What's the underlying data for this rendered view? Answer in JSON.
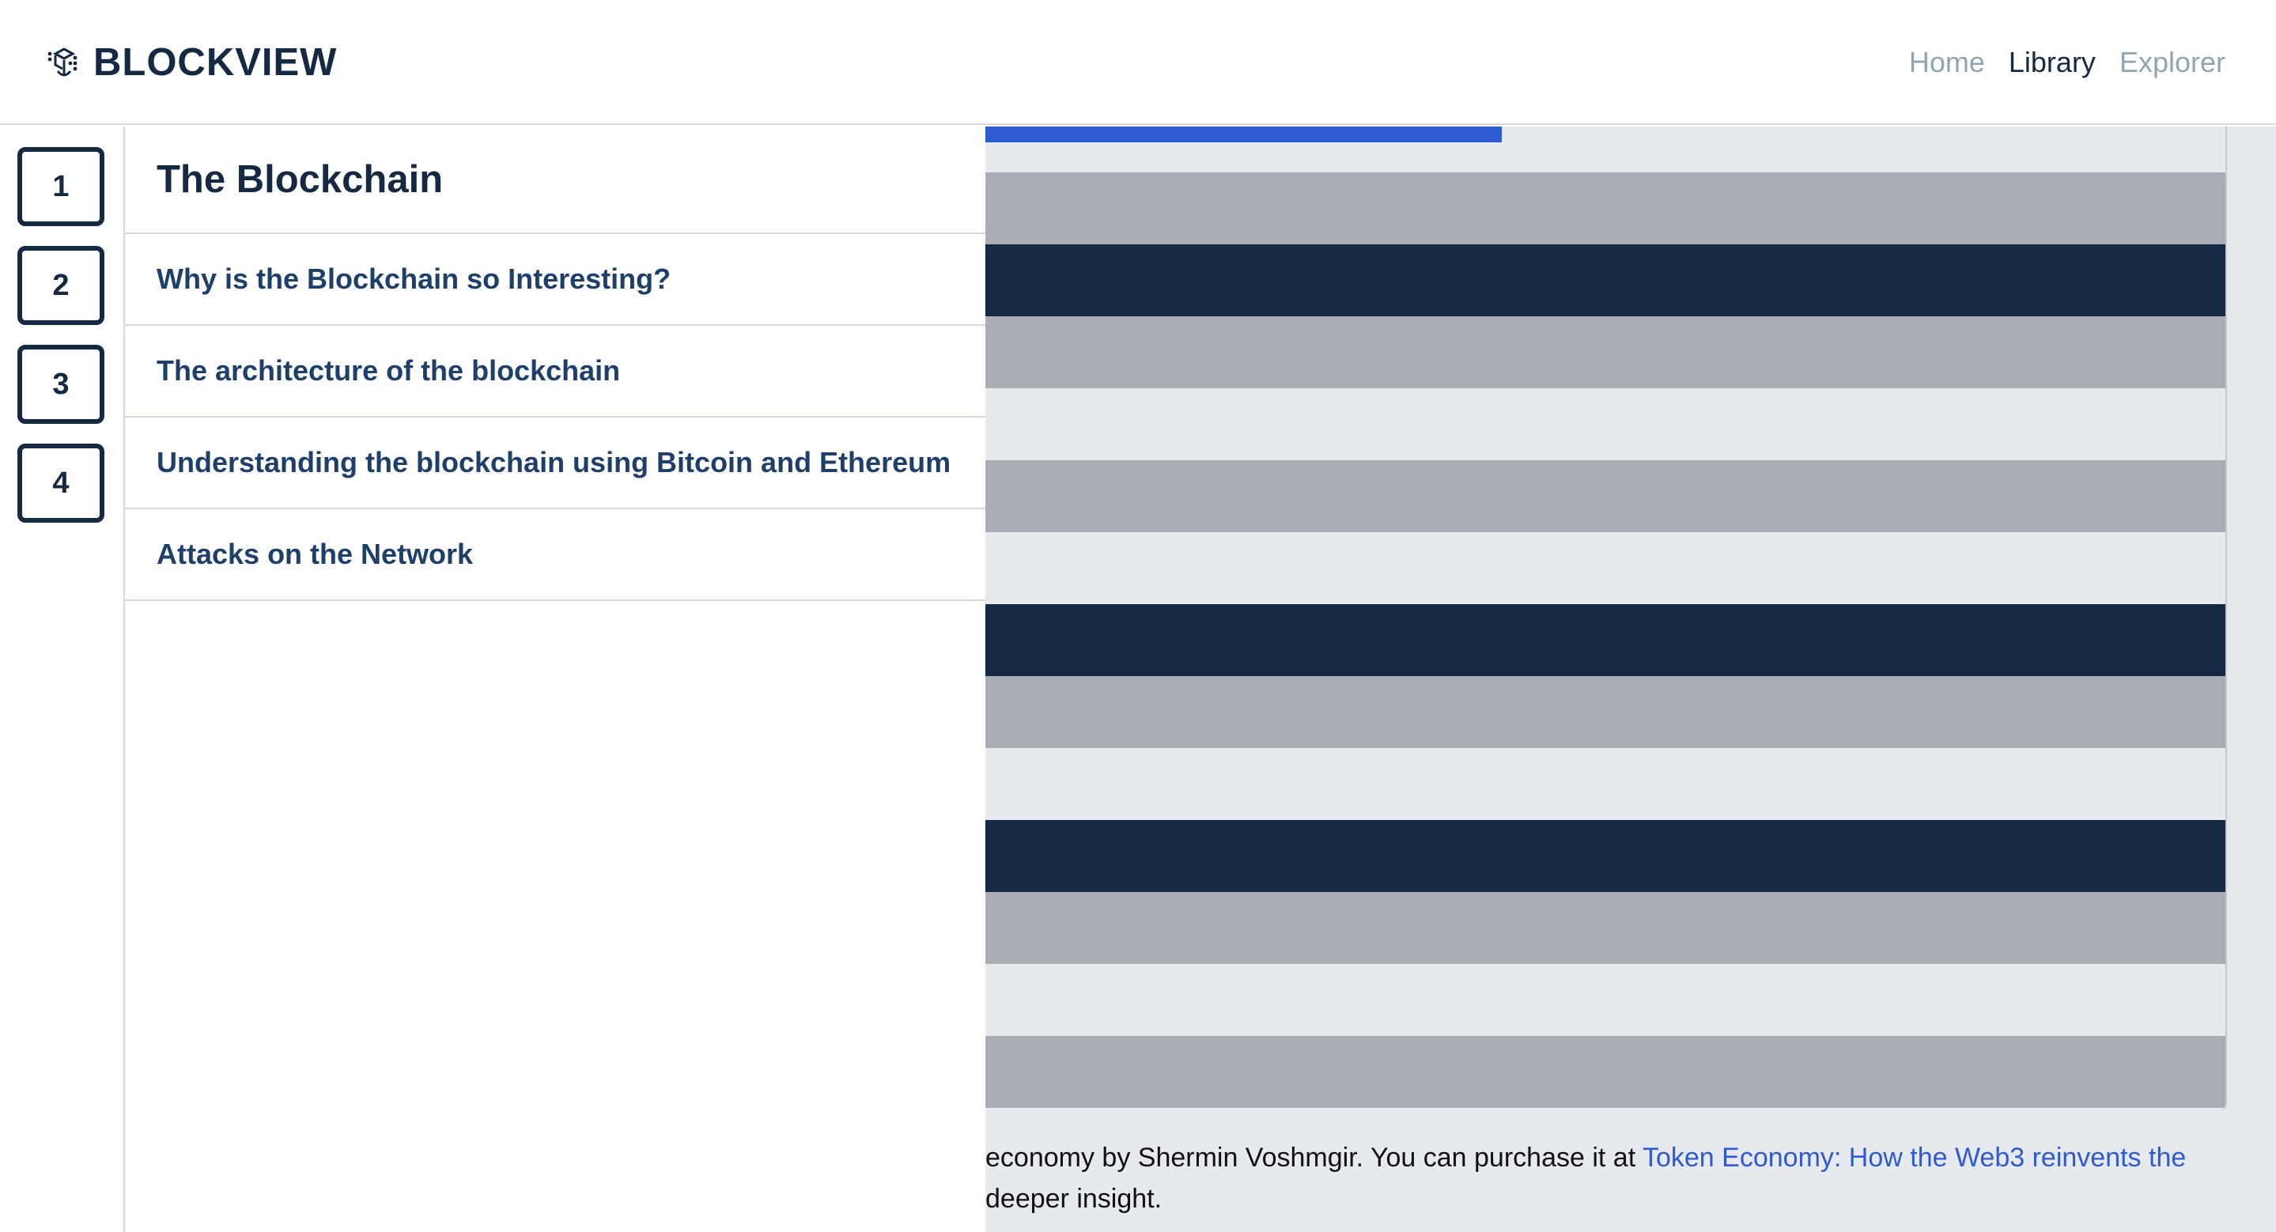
{
  "header": {
    "brand": "BLOCKVIEW",
    "brand_icon": "cube-icon",
    "nav": [
      {
        "label": "Home",
        "active": false
      },
      {
        "label": "Library",
        "active": true
      },
      {
        "label": "Explorer",
        "active": false
      }
    ]
  },
  "chapters": {
    "numbers": [
      "1",
      "2",
      "3",
      "4"
    ],
    "title": "The Blockchain",
    "items": [
      "Why is the Blockchain so Interesting?",
      "The architecture of the blockchain",
      "Understanding the blockchain using Bitcoin and Ethereum",
      "Attacks on the Network"
    ]
  },
  "content": {
    "progress": 0.4,
    "stripes": [
      "gray",
      "navy",
      "gray",
      "light",
      "gray",
      "light",
      "navy",
      "gray",
      "light",
      "navy",
      "gray",
      "light",
      "gray"
    ],
    "caption": {
      "text_before": "economy by Shermin Voshmgir. You can purchase it at ",
      "link": "Token Economy: How the Web3 reinvents the",
      "text_after": " deeper insight."
    }
  },
  "colors": {
    "navy": "#152942",
    "gray": "#aaadb4",
    "light": "#e6e9ee",
    "accent": "#2f5bd2",
    "nav_inactive": "#8fa6b0"
  }
}
